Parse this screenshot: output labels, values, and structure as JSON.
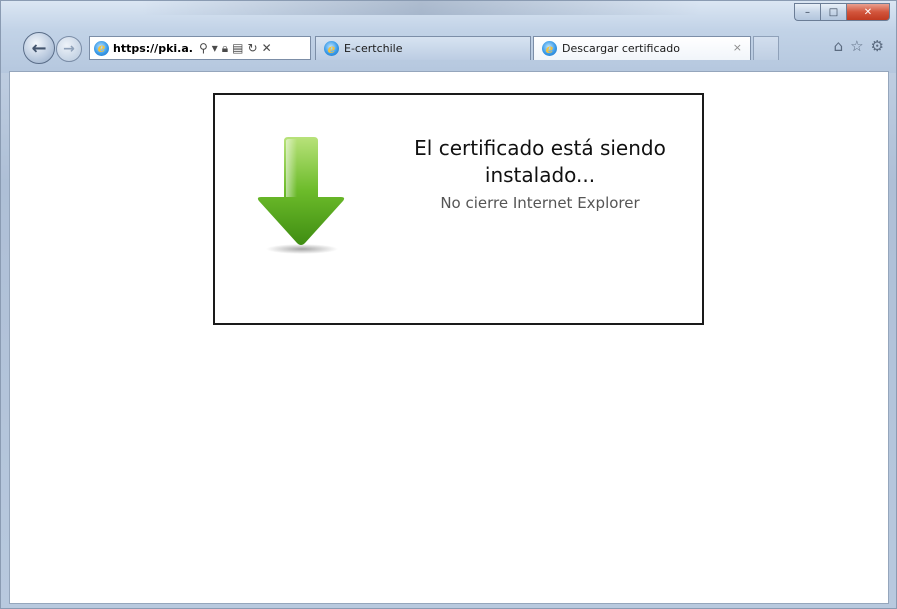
{
  "browser": {
    "address_url_bold": "https://pki.a.",
    "tabs": [
      {
        "label": "E-certchile",
        "active": false
      },
      {
        "label": "Descargar certificado",
        "active": true
      }
    ],
    "tab_close_glyph": "×",
    "caption": {
      "minimize": "–",
      "maximize": "□",
      "close": "✕"
    },
    "toolbar_icons": [
      "home-icon",
      "favorites-star-icon",
      "tools-gear-icon"
    ],
    "address_icons": [
      "search-icon",
      "dropdown-icon",
      "lock-icon",
      "compatibility-icon",
      "refresh-icon",
      "stop-icon"
    ]
  },
  "dialog": {
    "title": "El certificado está siendo instalado...",
    "subtitle": "No cierre Internet Explorer",
    "icon": "download-arrow-icon",
    "arrow_color": "#5aaa1e"
  }
}
